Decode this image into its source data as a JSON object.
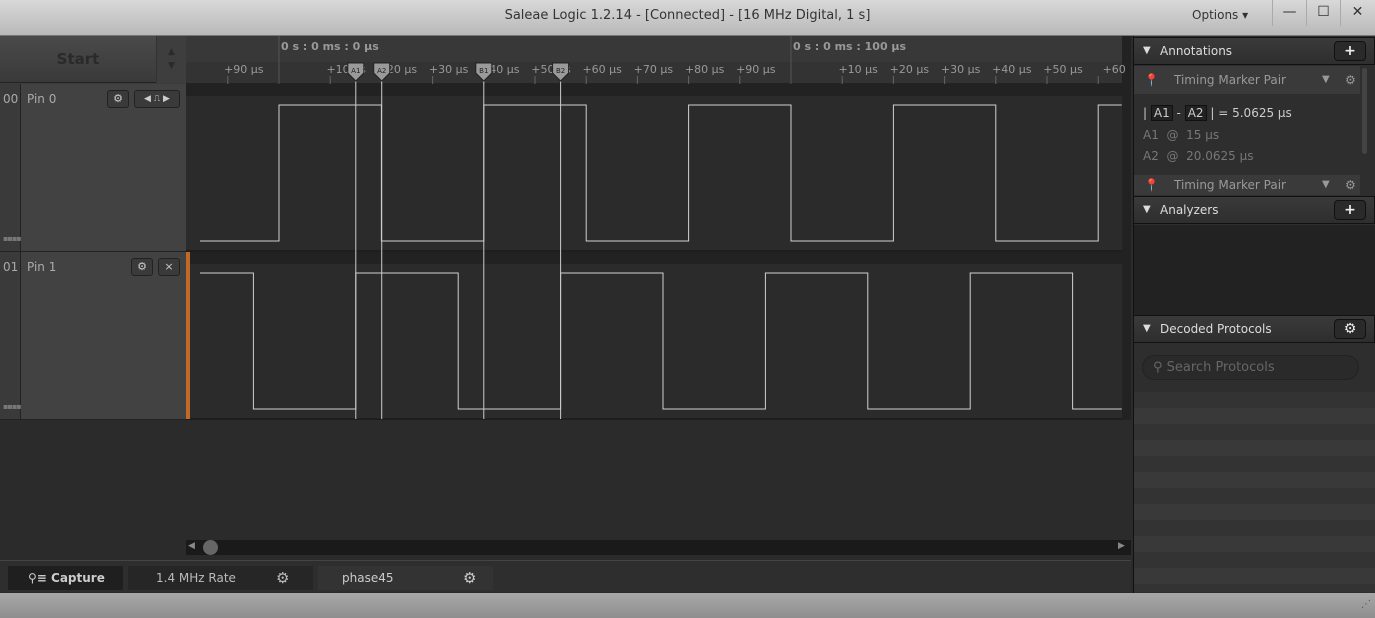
{
  "window": {
    "title": "Saleae Logic 1.2.14 - [Connected] - [16 MHz Digital, 1 s]",
    "options_label": "Options ▾",
    "minimize": "—",
    "maximize": "☐",
    "close": "✕"
  },
  "capture": {
    "start_label": "Start"
  },
  "channels": [
    {
      "number": "00",
      "name": "Pin 0",
      "trigger_icon": "falling-edge-trigger"
    },
    {
      "number": "01",
      "name": "Pin 1",
      "close_label": "×"
    }
  ],
  "timeline": {
    "major_labels": [
      "0 s : 0 ms : 0 µs",
      "0 s : 0 ms : 100 µs"
    ],
    "tick_labels_first": [
      "+90 µs",
      "+10 µs",
      "+20 µs",
      "+30 µs",
      "+40 µs",
      "+50 µs",
      "+60 µs",
      "+70 µs",
      "+80 µs",
      "+90 µs"
    ],
    "tick_labels_second": [
      "+10 µs",
      "+20 µs",
      "+30 µs",
      "+40 µs",
      "+50 µs",
      "+60"
    ],
    "markers": [
      {
        "label": "A1",
        "time_us": 15
      },
      {
        "label": "A2",
        "time_us": 20.0625
      },
      {
        "label": "B1",
        "time_us": 40
      },
      {
        "label": "B2",
        "time_us": 55
      }
    ]
  },
  "signals": {
    "view_start_us": -16.8,
    "view_end_us": 164.6,
    "period_us": 40,
    "high_us": 20,
    "pins": [
      {
        "name": "Pin 0",
        "first_rise_us": 0
      },
      {
        "name": "Pin 1",
        "first_rise_us": 15
      }
    ]
  },
  "annotations": {
    "title": "Annotations",
    "add": "+",
    "items": [
      {
        "title": "Timing Marker Pair",
        "marker1": "A1",
        "marker2": "A2",
        "diff": "5.0625 µs",
        "t1": "15 µs",
        "t2": "20.0625 µs",
        "at": "@",
        "eq": "=",
        "sep": "-"
      },
      {
        "title": "Timing Marker Pair"
      }
    ]
  },
  "analyzers": {
    "title": "Analyzers",
    "add": "+"
  },
  "decoded": {
    "title": "Decoded Protocols",
    "search_placeholder": "Search Protocols"
  },
  "tabs": [
    {
      "label": "Capture"
    },
    {
      "label": "1.4 MHz Rate"
    },
    {
      "label": "phase45"
    }
  ],
  "colors": {
    "trace": "#d0d0d0",
    "background": "#2b2b2b",
    "trigger_bar": "#c06a2a"
  }
}
